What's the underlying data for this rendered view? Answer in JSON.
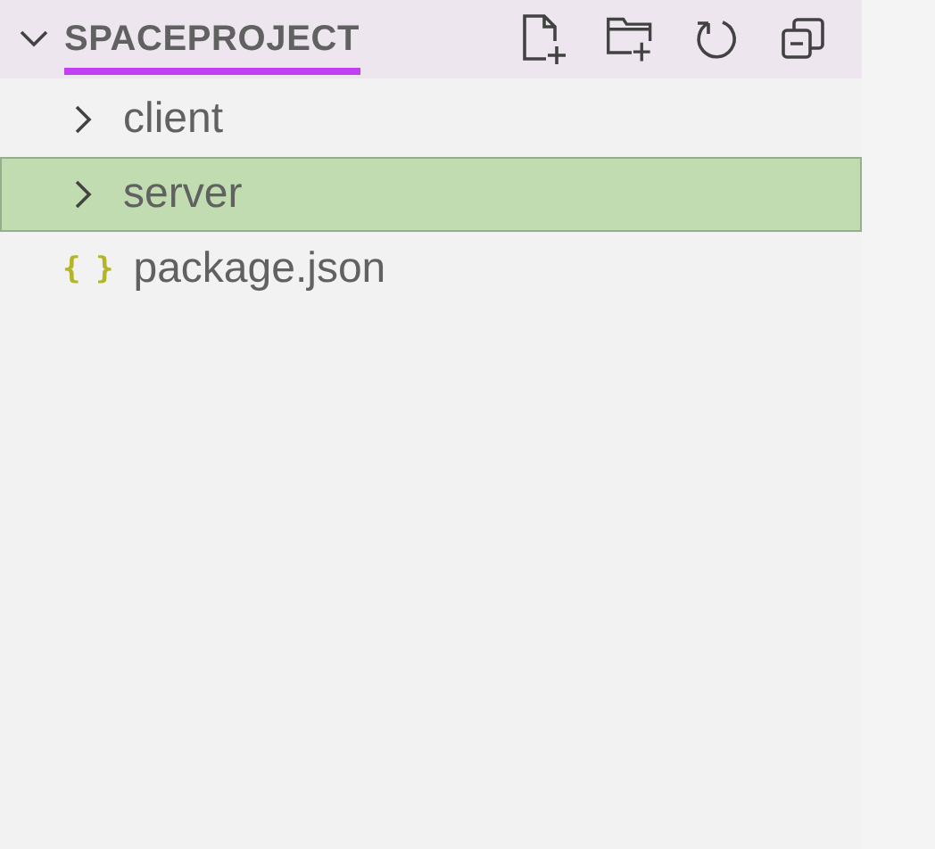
{
  "explorer": {
    "title": "SPACEPROJECT",
    "expanded": true,
    "items": [
      {
        "kind": "folder",
        "label": "client",
        "expanded": false,
        "selected": false
      },
      {
        "kind": "folder",
        "label": "server",
        "expanded": false,
        "selected": true
      },
      {
        "kind": "file",
        "label": "package.json",
        "icon": "{ }",
        "selected": false
      }
    ]
  }
}
